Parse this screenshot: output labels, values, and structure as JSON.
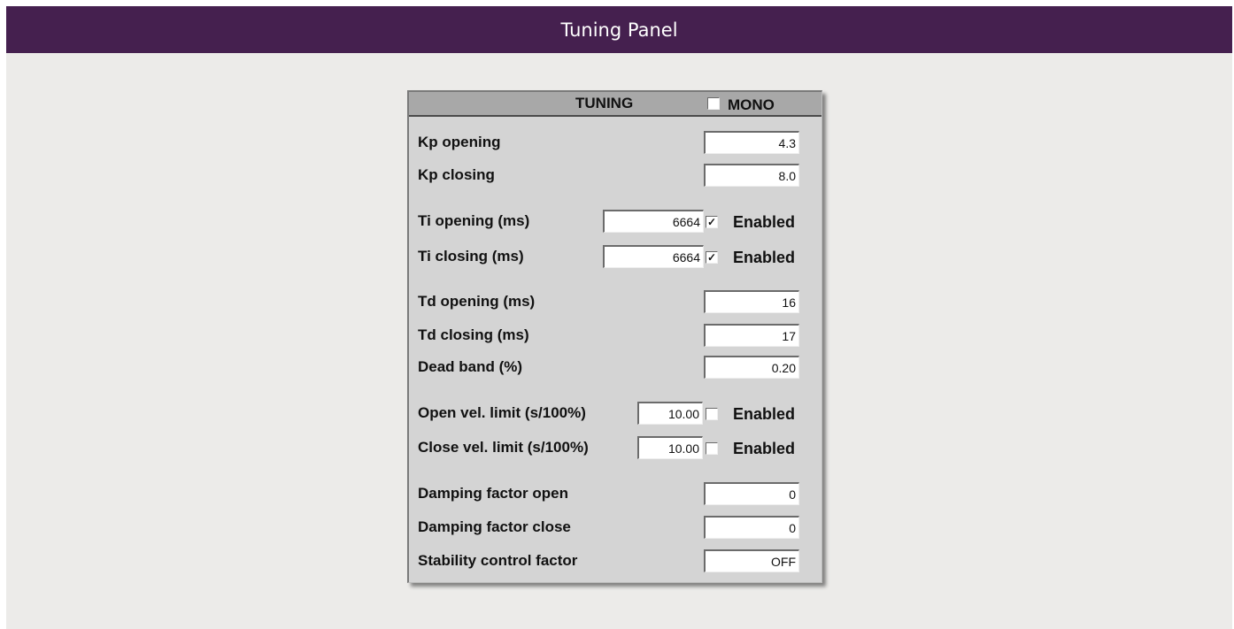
{
  "banner": {
    "title": "Tuning Panel"
  },
  "panel": {
    "header_title": "TUNING",
    "mono_label": "MONO",
    "mono_checked": false,
    "enabled_label": "Enabled",
    "rows": {
      "kp_opening": {
        "label": "Kp opening",
        "value": "4.3"
      },
      "kp_closing": {
        "label": "Kp closing",
        "value": "8.0"
      },
      "ti_opening": {
        "label": "Ti opening (ms)",
        "value": "6664",
        "enabled": true
      },
      "ti_closing": {
        "label": "Ti closing (ms)",
        "value": "6664",
        "enabled": true
      },
      "td_opening": {
        "label": "Td opening (ms)",
        "value": "16"
      },
      "td_closing": {
        "label": "Td closing (ms)",
        "value": "17"
      },
      "dead_band": {
        "label": "Dead band (%)",
        "value": "0.20"
      },
      "open_vel": {
        "label": "Open  vel. limit (s/100%)",
        "value": "10.00",
        "enabled": false
      },
      "close_vel": {
        "label": "Close vel. limit (s/100%)",
        "value": "10.00",
        "enabled": false
      },
      "damping_open": {
        "label": "Damping factor open",
        "value": "0"
      },
      "damping_close": {
        "label": "Damping factor close",
        "value": "0"
      },
      "stability": {
        "label": "Stability control factor",
        "value": "OFF"
      }
    }
  }
}
